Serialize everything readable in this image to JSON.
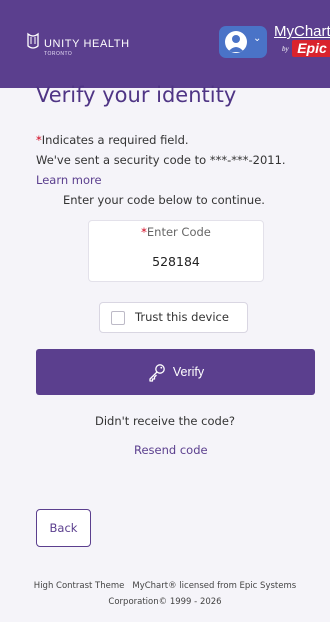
{
  "header": {
    "logo_text": "UNITY HEALTH",
    "logo_sub": "TORONTO",
    "user_menu_chevron": "⌄",
    "mychart_text": "MyChart",
    "mychart_by": "by",
    "epic_text": "Epic",
    "colors": {
      "background": "#5b3f8e",
      "user_button": "#4a73c7",
      "epic": "#d9232d"
    }
  },
  "page": {
    "title": "Verify your identity",
    "required_star": "*",
    "required_text": "Indicates a required field.",
    "sent_text": "We've sent a security code to ***-***-2011.",
    "learn_more": "Learn more",
    "enter_instructions": "Enter your code below to continue."
  },
  "code_field": {
    "required_star": "*",
    "label": "Enter Code",
    "value": "528184"
  },
  "trust_device": {
    "label": "Trust this device",
    "checked": false
  },
  "verify_button": {
    "label": "Verify",
    "icon": "key-icon"
  },
  "resend": {
    "question": "Didn't receive the code?",
    "link": "Resend code"
  },
  "back_button": {
    "label": "Back"
  },
  "footer": {
    "high_contrast": "High Contrast Theme",
    "license_line1": "MyChart® licensed from Epic Systems",
    "license_line2": "Corporation© 1999 - 2026"
  }
}
